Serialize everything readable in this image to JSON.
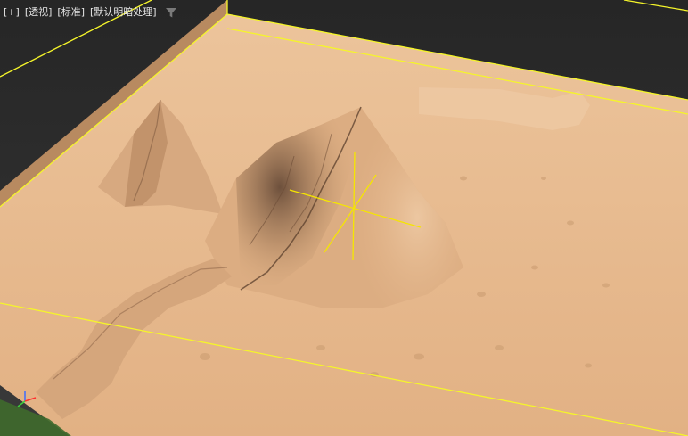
{
  "viewport": {
    "menus": [
      {
        "label": "[+]"
      },
      {
        "label": "[透视]"
      },
      {
        "label": "[标准]"
      },
      {
        "label": "[默认明暗处理]"
      }
    ],
    "filter_icon": "filter-funnel-icon"
  },
  "scene": {
    "object": "terrain-plane",
    "selection_color": "#f5f52a",
    "terrain_color": "#e8b98c",
    "gizmo_color": "#f5e600"
  },
  "axis_tripod": {
    "axes": [
      {
        "label": "z",
        "color": "#3c6cff"
      },
      {
        "label": "x",
        "color": "#ff3030"
      },
      {
        "label": "y",
        "color": "#3ccf3c"
      }
    ]
  }
}
